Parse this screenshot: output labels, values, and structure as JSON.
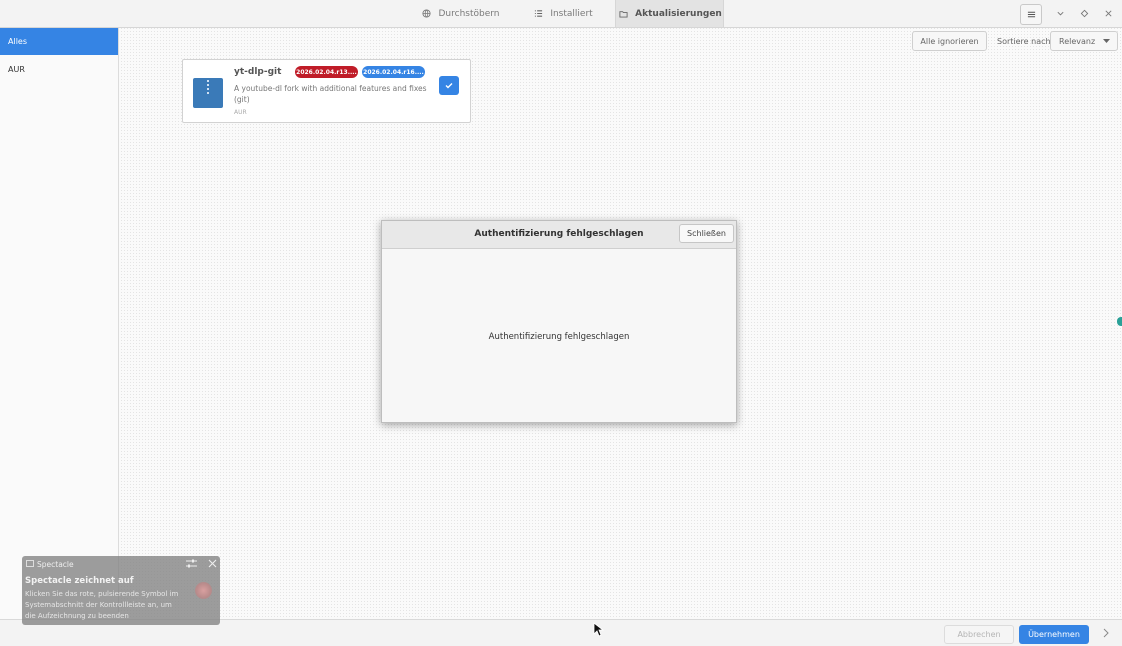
{
  "header": {
    "tabs": [
      {
        "label": "Durchstöbern",
        "icon": "globe-icon"
      },
      {
        "label": "Installiert",
        "icon": "list-icon"
      },
      {
        "label": "Aktualisierungen",
        "icon": "folder-icon"
      }
    ]
  },
  "sidebar": {
    "items": [
      {
        "label": "Alles"
      },
      {
        "label": "AUR"
      }
    ]
  },
  "toolbar": {
    "ignore_all": "Alle ignorieren",
    "sort_label": "Sortiere nach",
    "sort_value": "Relevanz"
  },
  "package": {
    "name": "yt-dlp-git",
    "old_version": "2026.02.04.r13....",
    "new_version": "2026.02.04.r16....",
    "description": "A youtube-dl fork with additional features and fixes (git)",
    "repo": "AUR",
    "colors": {
      "old": "#c01c28",
      "new": "#3584e4"
    }
  },
  "dialog": {
    "title": "Authentifizierung fehlgeschlagen",
    "close_label": "Schließen",
    "message": "Authentifizierung fehlgeschlagen"
  },
  "bottom": {
    "cancel_label": "Abbrechen",
    "apply_label": "Übernehmen"
  },
  "notification": {
    "app": "Spectacle",
    "title": "Spectacle zeichnet auf",
    "body": "Klicken Sie das rote, pulsierende Symbol im Systemabschnitt der Kontrollleiste an, um die Aufzeichnung zu beenden"
  },
  "colors": {
    "accent": "#3584e4"
  }
}
